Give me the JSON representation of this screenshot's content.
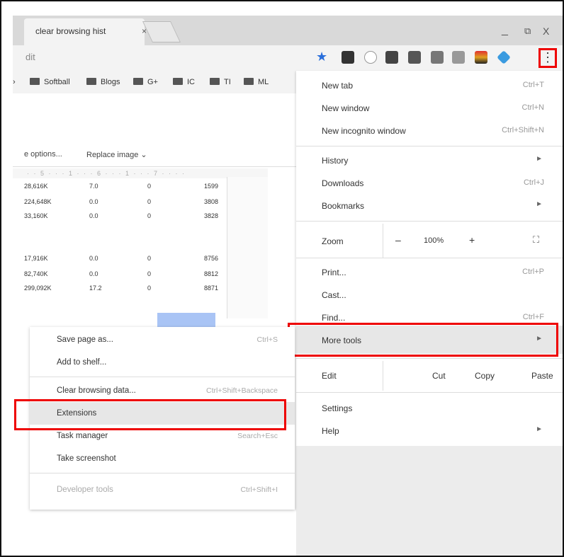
{
  "tab": {
    "title": "clear browsing hist",
    "close": "×"
  },
  "window": {
    "minimize": "_",
    "restore": "⧉",
    "close": "X"
  },
  "omnibox": {
    "text": "dit"
  },
  "menu_button": {
    "glyph": "⋮"
  },
  "bookmarks": [
    {
      "label": "Softball"
    },
    {
      "label": "Blogs"
    },
    {
      "label": "G+"
    },
    {
      "label": "IC"
    },
    {
      "label": "TI"
    },
    {
      "label": "ML"
    }
  ],
  "doc": {
    "toolbar": {
      "image_options": "e options...",
      "replace_image": "Replace image ⌄"
    },
    "ruler": "· · 5 · · · 1 · · · 6 · · · 1 · · · 7 · · · ·",
    "rows": [
      [
        "28,616K",
        "7.0",
        "0",
        "1599"
      ],
      [
        "224,648K",
        "0.0",
        "0",
        "3808"
      ],
      [
        "33,160K",
        "0.0",
        "0",
        "3828"
      ],
      [
        "17,916K",
        "0.0",
        "0",
        "8756"
      ],
      [
        "82,740K",
        "0.0",
        "0",
        "8812"
      ],
      [
        "299,092K",
        "17.2",
        "0",
        "8871"
      ]
    ]
  },
  "menu": {
    "new_tab": {
      "label": "New tab",
      "shortcut": "Ctrl+T"
    },
    "new_window": {
      "label": "New window",
      "shortcut": "Ctrl+N"
    },
    "new_incognito": {
      "label": "New incognito window",
      "shortcut": "Ctrl+Shift+N"
    },
    "history": {
      "label": "History",
      "arrow": "►"
    },
    "downloads": {
      "label": "Downloads",
      "shortcut": "Ctrl+J"
    },
    "bookmarks": {
      "label": "Bookmarks",
      "arrow": "►"
    },
    "zoom": {
      "label": "Zoom",
      "minus": "–",
      "value": "100%",
      "plus": "+",
      "fullscreen": "⛶"
    },
    "print": {
      "label": "Print...",
      "shortcut": "Ctrl+P"
    },
    "cast": {
      "label": "Cast..."
    },
    "find": {
      "label": "Find...",
      "shortcut": "Ctrl+F"
    },
    "more_tools": {
      "label": "More tools",
      "arrow": "►"
    },
    "edit": {
      "label": "Edit",
      "cut": "Cut",
      "copy": "Copy",
      "paste": "Paste"
    },
    "settings": {
      "label": "Settings"
    },
    "help": {
      "label": "Help",
      "arrow": "►"
    }
  },
  "submenu": {
    "save_page": {
      "label": "Save page as...",
      "shortcut": "Ctrl+S"
    },
    "add_to_shelf": {
      "label": "Add to shelf..."
    },
    "clear_data": {
      "label": "Clear browsing data...",
      "shortcut": "Ctrl+Shift+Backspace"
    },
    "extensions": {
      "label": "Extensions"
    },
    "task_manager": {
      "label": "Task manager",
      "shortcut": "Search+Esc"
    },
    "screenshot": {
      "label": "Take screenshot"
    },
    "dev_tools": {
      "label": "Developer tools",
      "shortcut": "Ctrl+Shift+I"
    }
  },
  "colors": {
    "highlight_box": "#e00000",
    "star": "#2a6fdb"
  }
}
